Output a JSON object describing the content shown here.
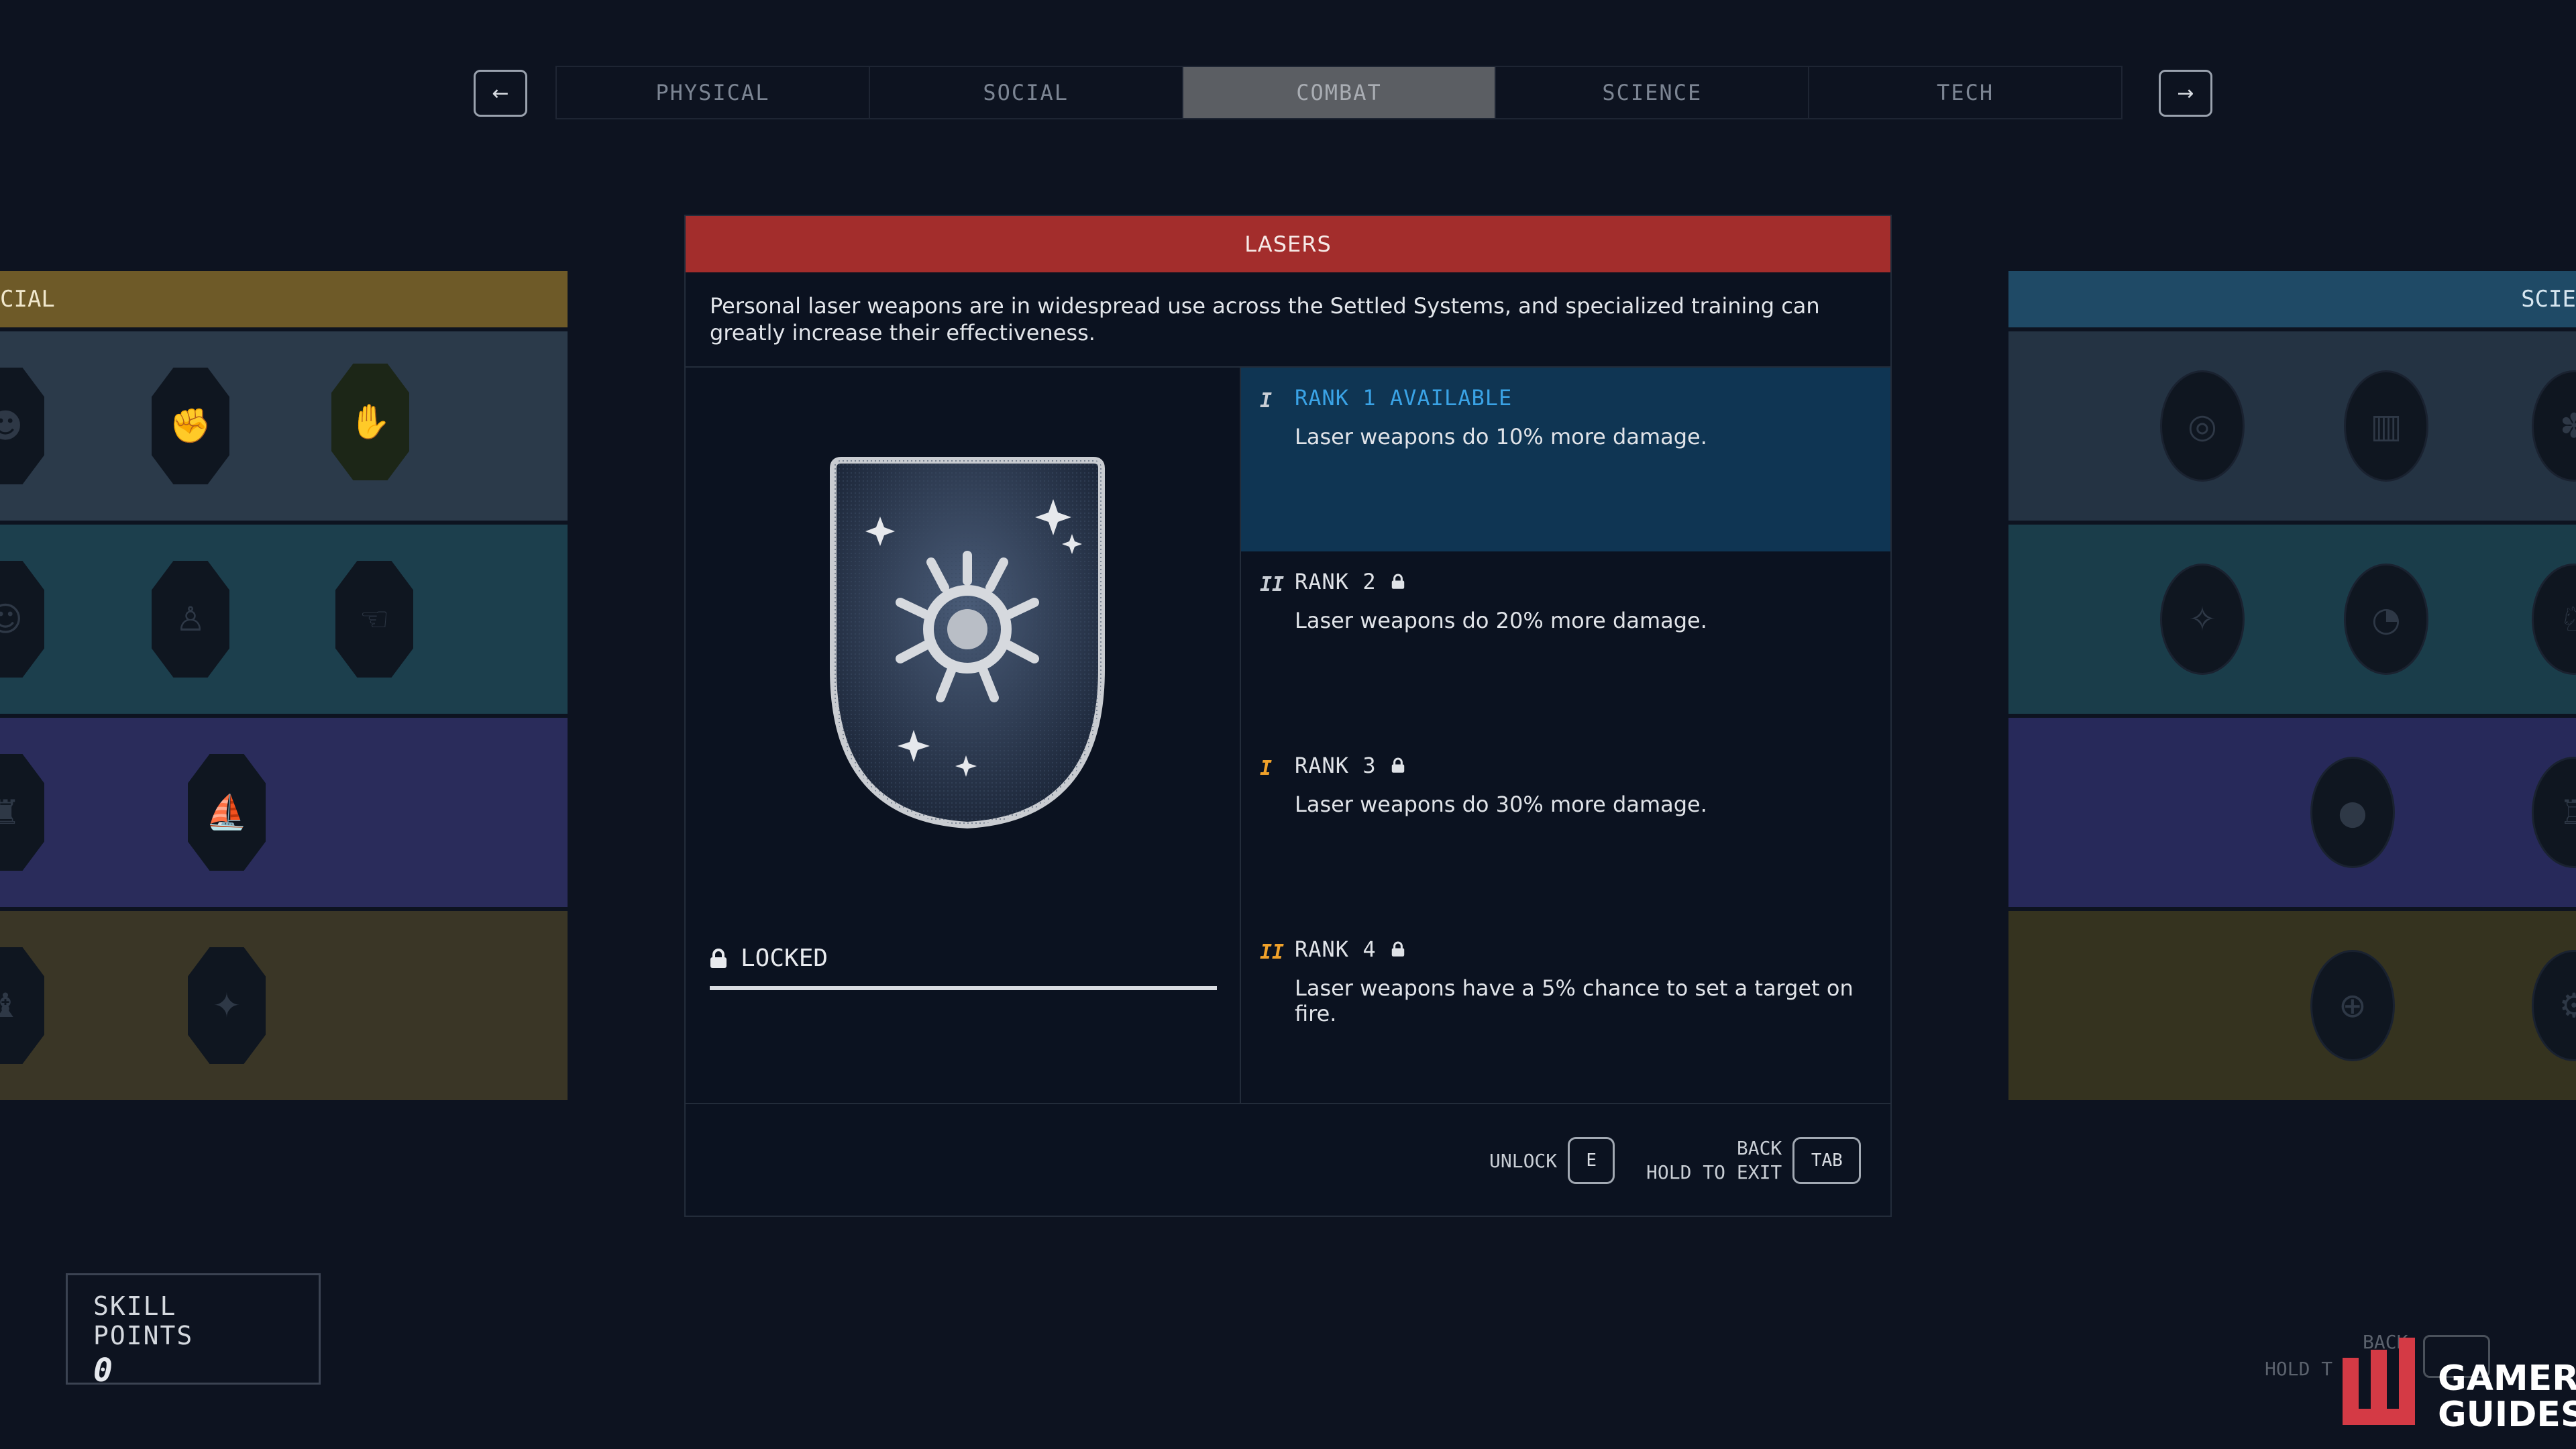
{
  "nav": {
    "prev_icon": "←",
    "next_icon": "→",
    "tabs": [
      {
        "label": "PHYSICAL",
        "active": false
      },
      {
        "label": "SOCIAL",
        "active": false
      },
      {
        "label": "COMBAT",
        "active": true
      },
      {
        "label": "SCIENCE",
        "active": false
      },
      {
        "label": "TECH",
        "active": false
      }
    ]
  },
  "side_left": {
    "header": "CIAL"
  },
  "side_right": {
    "header": "SCIE"
  },
  "skill": {
    "title": "LASERS",
    "description": "Personal laser weapons are in widespread use across the Settled Systems, and specialized training can greatly increase their effectiveness.",
    "status": "LOCKED",
    "progress": 0,
    "ranks": [
      {
        "mark": "I",
        "title": "RANK 1 AVAILABLE",
        "desc": "Laser weapons do 10% more damage.",
        "locked": false
      },
      {
        "mark": "II",
        "title": "RANK 2",
        "desc": "Laser weapons do 20% more damage.",
        "locked": true
      },
      {
        "mark": "I",
        "title": "RANK 3",
        "desc": "Laser weapons do 30% more damage.",
        "locked": true
      },
      {
        "mark": "II",
        "title": "RANK 4",
        "desc": "Laser weapons have a 5% chance to set a target on fire.",
        "locked": true
      }
    ]
  },
  "footer": {
    "unlock_label": "UNLOCK",
    "unlock_key": "E",
    "back_label": "BACK",
    "hold_label": "HOLD TO EXIT",
    "back_key": "TAB"
  },
  "skill_points": {
    "label": "SKILL POINTS",
    "value": "0"
  },
  "ghost": {
    "back": "BACK",
    "hold": "HOLD T"
  },
  "watermark": {
    "line1": "GAMER",
    "line2": "GUIDES"
  },
  "colors": {
    "title_bar": "#a32d2c",
    "rank_available": "#3aa3e6",
    "rank_available_bg": "#0f3553",
    "mark_orange": "#f0a12a",
    "mark_grey": "#c9ced5"
  }
}
